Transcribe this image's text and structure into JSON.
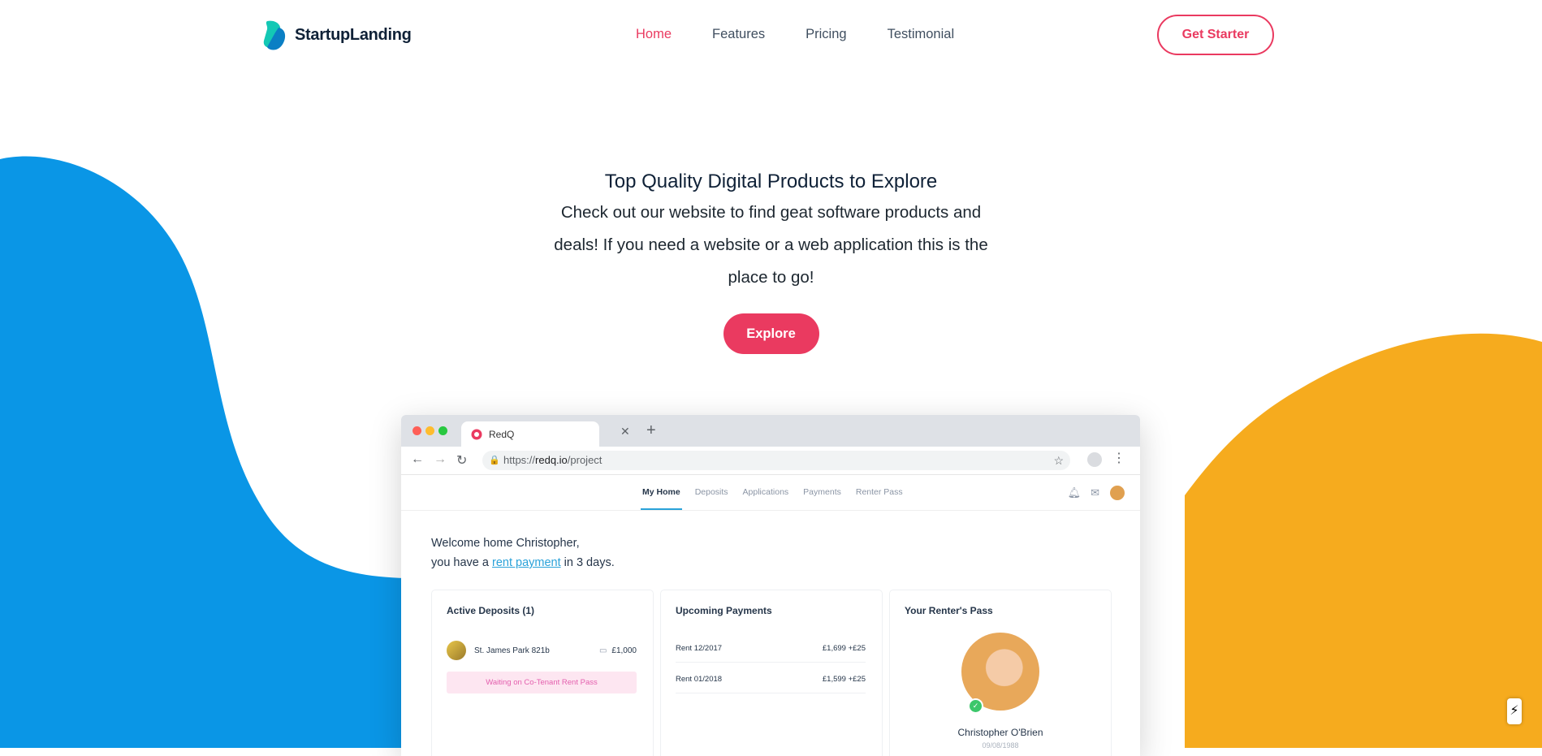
{
  "brand": {
    "name": "StartupLanding",
    "accent": "#ea3a60",
    "blue": "#0a96e6",
    "orange": "#f6ab1e"
  },
  "nav": {
    "links": [
      {
        "label": "Home",
        "active": true
      },
      {
        "label": "Features",
        "active": false
      },
      {
        "label": "Pricing",
        "active": false
      },
      {
        "label": "Testimonial",
        "active": false
      }
    ],
    "cta_label": "Get Starter"
  },
  "hero": {
    "title": "Top Quality Digital Products to Explore",
    "text": "Check out our website to find geat software products and deals! If you need a website or a web application this is the place to go!",
    "button_label": "Explore"
  },
  "mockup": {
    "tab_title": "RedQ",
    "url_prefix": "https://",
    "url_domain": "redq.io",
    "url_path": "/project",
    "app_tabs": [
      "My Home",
      "Deposits",
      "Applications",
      "Payments",
      "Renter Pass"
    ],
    "welcome_line1": "Welcome home Christopher,",
    "welcome_pre": "you have a ",
    "welcome_link": "rent payment",
    "welcome_post": " in 3 days.",
    "deposits": {
      "title": "Active Deposits (1)",
      "address": "St. James Park 821b",
      "amount": "£1,000",
      "status": "Waiting on Co-Tenant Rent Pass"
    },
    "payments": {
      "title": "Upcoming Payments",
      "rows": [
        {
          "label": "Rent 12/2017",
          "amount": "£1,699 +£25"
        },
        {
          "label": "Rent 01/2018",
          "amount": "£1,599 +£25"
        }
      ]
    },
    "pass": {
      "title": "Your Renter's Pass",
      "name": "Christopher O'Brien",
      "date": "09/08/1988"
    }
  },
  "icons": [
    "close-icon",
    "plus-icon",
    "back-arrow-icon",
    "forward-arrow-icon",
    "reload-icon",
    "lock-icon",
    "star-icon",
    "menu-dots-icon",
    "bell-icon",
    "mail-icon",
    "bolt-icon",
    "cash-icon",
    "check-icon"
  ]
}
